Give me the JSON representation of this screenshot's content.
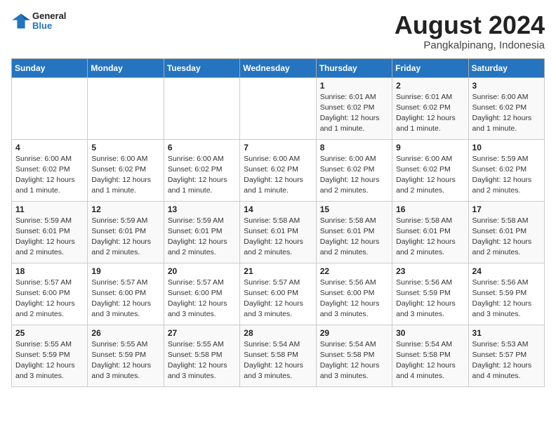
{
  "header": {
    "logo_general": "General",
    "logo_blue": "Blue",
    "title": "August 2024",
    "subtitle": "Pangkalpinang, Indonesia"
  },
  "weekdays": [
    "Sunday",
    "Monday",
    "Tuesday",
    "Wednesday",
    "Thursday",
    "Friday",
    "Saturday"
  ],
  "weeks": [
    [
      {
        "day": "",
        "info": ""
      },
      {
        "day": "",
        "info": ""
      },
      {
        "day": "",
        "info": ""
      },
      {
        "day": "",
        "info": ""
      },
      {
        "day": "1",
        "info": "Sunrise: 6:01 AM\nSunset: 6:02 PM\nDaylight: 12 hours\nand 1 minute."
      },
      {
        "day": "2",
        "info": "Sunrise: 6:01 AM\nSunset: 6:02 PM\nDaylight: 12 hours\nand 1 minute."
      },
      {
        "day": "3",
        "info": "Sunrise: 6:00 AM\nSunset: 6:02 PM\nDaylight: 12 hours\nand 1 minute."
      }
    ],
    [
      {
        "day": "4",
        "info": "Sunrise: 6:00 AM\nSunset: 6:02 PM\nDaylight: 12 hours\nand 1 minute."
      },
      {
        "day": "5",
        "info": "Sunrise: 6:00 AM\nSunset: 6:02 PM\nDaylight: 12 hours\nand 1 minute."
      },
      {
        "day": "6",
        "info": "Sunrise: 6:00 AM\nSunset: 6:02 PM\nDaylight: 12 hours\nand 1 minute."
      },
      {
        "day": "7",
        "info": "Sunrise: 6:00 AM\nSunset: 6:02 PM\nDaylight: 12 hours\nand 1 minute."
      },
      {
        "day": "8",
        "info": "Sunrise: 6:00 AM\nSunset: 6:02 PM\nDaylight: 12 hours\nand 2 minutes."
      },
      {
        "day": "9",
        "info": "Sunrise: 6:00 AM\nSunset: 6:02 PM\nDaylight: 12 hours\nand 2 minutes."
      },
      {
        "day": "10",
        "info": "Sunrise: 5:59 AM\nSunset: 6:02 PM\nDaylight: 12 hours\nand 2 minutes."
      }
    ],
    [
      {
        "day": "11",
        "info": "Sunrise: 5:59 AM\nSunset: 6:01 PM\nDaylight: 12 hours\nand 2 minutes."
      },
      {
        "day": "12",
        "info": "Sunrise: 5:59 AM\nSunset: 6:01 PM\nDaylight: 12 hours\nand 2 minutes."
      },
      {
        "day": "13",
        "info": "Sunrise: 5:59 AM\nSunset: 6:01 PM\nDaylight: 12 hours\nand 2 minutes."
      },
      {
        "day": "14",
        "info": "Sunrise: 5:58 AM\nSunset: 6:01 PM\nDaylight: 12 hours\nand 2 minutes."
      },
      {
        "day": "15",
        "info": "Sunrise: 5:58 AM\nSunset: 6:01 PM\nDaylight: 12 hours\nand 2 minutes."
      },
      {
        "day": "16",
        "info": "Sunrise: 5:58 AM\nSunset: 6:01 PM\nDaylight: 12 hours\nand 2 minutes."
      },
      {
        "day": "17",
        "info": "Sunrise: 5:58 AM\nSunset: 6:01 PM\nDaylight: 12 hours\nand 2 minutes."
      }
    ],
    [
      {
        "day": "18",
        "info": "Sunrise: 5:57 AM\nSunset: 6:00 PM\nDaylight: 12 hours\nand 2 minutes."
      },
      {
        "day": "19",
        "info": "Sunrise: 5:57 AM\nSunset: 6:00 PM\nDaylight: 12 hours\nand 3 minutes."
      },
      {
        "day": "20",
        "info": "Sunrise: 5:57 AM\nSunset: 6:00 PM\nDaylight: 12 hours\nand 3 minutes."
      },
      {
        "day": "21",
        "info": "Sunrise: 5:57 AM\nSunset: 6:00 PM\nDaylight: 12 hours\nand 3 minutes."
      },
      {
        "day": "22",
        "info": "Sunrise: 5:56 AM\nSunset: 6:00 PM\nDaylight: 12 hours\nand 3 minutes."
      },
      {
        "day": "23",
        "info": "Sunrise: 5:56 AM\nSunset: 5:59 PM\nDaylight: 12 hours\nand 3 minutes."
      },
      {
        "day": "24",
        "info": "Sunrise: 5:56 AM\nSunset: 5:59 PM\nDaylight: 12 hours\nand 3 minutes."
      }
    ],
    [
      {
        "day": "25",
        "info": "Sunrise: 5:55 AM\nSunset: 5:59 PM\nDaylight: 12 hours\nand 3 minutes."
      },
      {
        "day": "26",
        "info": "Sunrise: 5:55 AM\nSunset: 5:59 PM\nDaylight: 12 hours\nand 3 minutes."
      },
      {
        "day": "27",
        "info": "Sunrise: 5:55 AM\nSunset: 5:58 PM\nDaylight: 12 hours\nand 3 minutes."
      },
      {
        "day": "28",
        "info": "Sunrise: 5:54 AM\nSunset: 5:58 PM\nDaylight: 12 hours\nand 3 minutes."
      },
      {
        "day": "29",
        "info": "Sunrise: 5:54 AM\nSunset: 5:58 PM\nDaylight: 12 hours\nand 3 minutes."
      },
      {
        "day": "30",
        "info": "Sunrise: 5:54 AM\nSunset: 5:58 PM\nDaylight: 12 hours\nand 4 minutes."
      },
      {
        "day": "31",
        "info": "Sunrise: 5:53 AM\nSunset: 5:57 PM\nDaylight: 12 hours\nand 4 minutes."
      }
    ]
  ]
}
